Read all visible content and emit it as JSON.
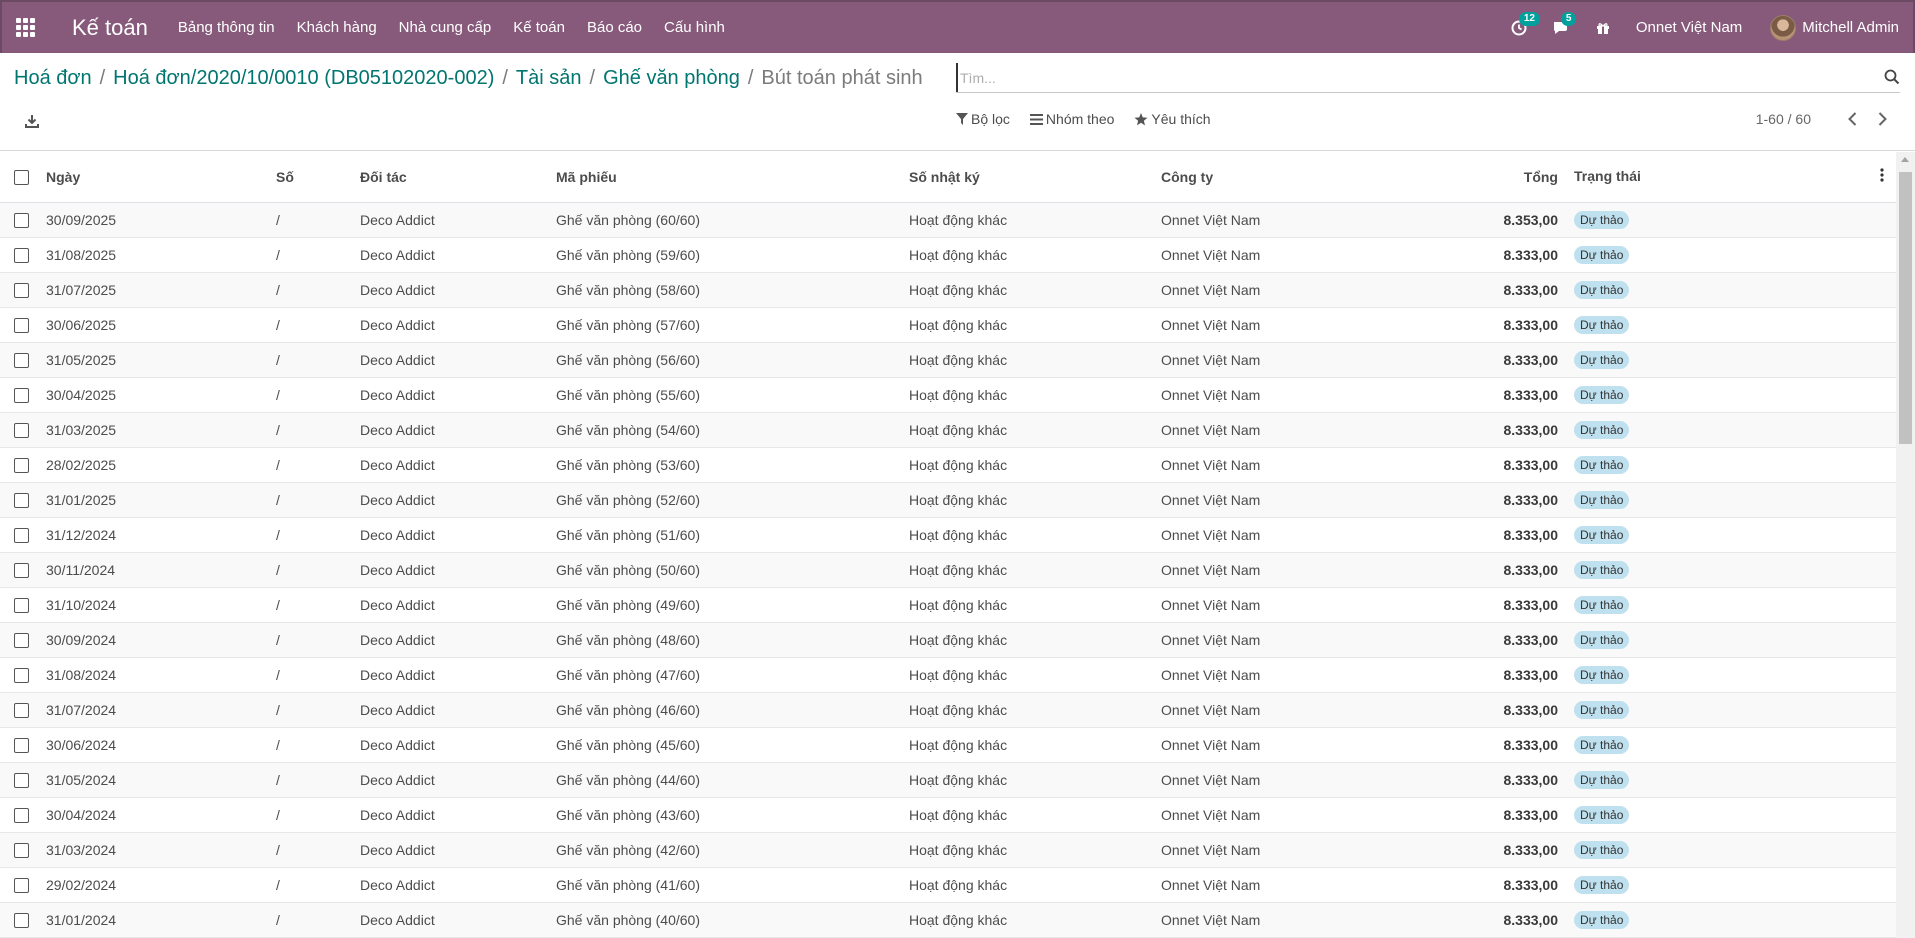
{
  "navbar": {
    "brand": "Kế toán",
    "menu": [
      "Bảng thông tin",
      "Khách hàng",
      "Nhà cung cấp",
      "Kế toán",
      "Báo cáo",
      "Cấu hình"
    ],
    "activity_count": "12",
    "message_count": "5",
    "company": "Onnet Việt Nam",
    "user": "Mitchell Admin",
    "bg_color": "#875a7b"
  },
  "breadcrumb": {
    "items": [
      "Hoá đơn",
      "Hoá đơn/2020/10/0010 (DB05102020-002)",
      "Tài sản",
      "Ghế văn phòng"
    ],
    "current": "Bút toán phát sinh"
  },
  "search": {
    "placeholder": "Tìm..."
  },
  "filters": {
    "filter": "Bộ lọc",
    "group_by": "Nhóm theo",
    "favorites": "Yêu thích"
  },
  "pager": {
    "value": "1-60 / 60"
  },
  "table": {
    "headers": [
      "Ngày",
      "Số",
      "Đối tác",
      "Mã phiếu",
      "Số nhật ký",
      "Công ty",
      "Tổng",
      "Trạng thái"
    ],
    "rows": [
      [
        "30/09/2025",
        "/",
        "Deco Addict",
        "Ghế văn phòng (60/60)",
        "Hoạt động khác",
        "Onnet Việt Nam",
        "8.353,00",
        "Dự thảo"
      ],
      [
        "31/08/2025",
        "/",
        "Deco Addict",
        "Ghế văn phòng (59/60)",
        "Hoạt động khác",
        "Onnet Việt Nam",
        "8.333,00",
        "Dự thảo"
      ],
      [
        "31/07/2025",
        "/",
        "Deco Addict",
        "Ghế văn phòng (58/60)",
        "Hoạt động khác",
        "Onnet Việt Nam",
        "8.333,00",
        "Dự thảo"
      ],
      [
        "30/06/2025",
        "/",
        "Deco Addict",
        "Ghế văn phòng (57/60)",
        "Hoạt động khác",
        "Onnet Việt Nam",
        "8.333,00",
        "Dự thảo"
      ],
      [
        "31/05/2025",
        "/",
        "Deco Addict",
        "Ghế văn phòng (56/60)",
        "Hoạt động khác",
        "Onnet Việt Nam",
        "8.333,00",
        "Dự thảo"
      ],
      [
        "30/04/2025",
        "/",
        "Deco Addict",
        "Ghế văn phòng (55/60)",
        "Hoạt động khác",
        "Onnet Việt Nam",
        "8.333,00",
        "Dự thảo"
      ],
      [
        "31/03/2025",
        "/",
        "Deco Addict",
        "Ghế văn phòng (54/60)",
        "Hoạt động khác",
        "Onnet Việt Nam",
        "8.333,00",
        "Dự thảo"
      ],
      [
        "28/02/2025",
        "/",
        "Deco Addict",
        "Ghế văn phòng (53/60)",
        "Hoạt động khác",
        "Onnet Việt Nam",
        "8.333,00",
        "Dự thảo"
      ],
      [
        "31/01/2025",
        "/",
        "Deco Addict",
        "Ghế văn phòng (52/60)",
        "Hoạt động khác",
        "Onnet Việt Nam",
        "8.333,00",
        "Dự thảo"
      ],
      [
        "31/12/2024",
        "/",
        "Deco Addict",
        "Ghế văn phòng (51/60)",
        "Hoạt động khác",
        "Onnet Việt Nam",
        "8.333,00",
        "Dự thảo"
      ],
      [
        "30/11/2024",
        "/",
        "Deco Addict",
        "Ghế văn phòng (50/60)",
        "Hoạt động khác",
        "Onnet Việt Nam",
        "8.333,00",
        "Dự thảo"
      ],
      [
        "31/10/2024",
        "/",
        "Deco Addict",
        "Ghế văn phòng (49/60)",
        "Hoạt động khác",
        "Onnet Việt Nam",
        "8.333,00",
        "Dự thảo"
      ],
      [
        "30/09/2024",
        "/",
        "Deco Addict",
        "Ghế văn phòng (48/60)",
        "Hoạt động khác",
        "Onnet Việt Nam",
        "8.333,00",
        "Dự thảo"
      ],
      [
        "31/08/2024",
        "/",
        "Deco Addict",
        "Ghế văn phòng (47/60)",
        "Hoạt động khác",
        "Onnet Việt Nam",
        "8.333,00",
        "Dự thảo"
      ],
      [
        "31/07/2024",
        "/",
        "Deco Addict",
        "Ghế văn phòng (46/60)",
        "Hoạt động khác",
        "Onnet Việt Nam",
        "8.333,00",
        "Dự thảo"
      ],
      [
        "30/06/2024",
        "/",
        "Deco Addict",
        "Ghế văn phòng (45/60)",
        "Hoạt động khác",
        "Onnet Việt Nam",
        "8.333,00",
        "Dự thảo"
      ],
      [
        "31/05/2024",
        "/",
        "Deco Addict",
        "Ghế văn phòng (44/60)",
        "Hoạt động khác",
        "Onnet Việt Nam",
        "8.333,00",
        "Dự thảo"
      ],
      [
        "30/04/2024",
        "/",
        "Deco Addict",
        "Ghế văn phòng (43/60)",
        "Hoạt động khác",
        "Onnet Việt Nam",
        "8.333,00",
        "Dự thảo"
      ],
      [
        "31/03/2024",
        "/",
        "Deco Addict",
        "Ghế văn phòng (42/60)",
        "Hoạt động khác",
        "Onnet Việt Nam",
        "8.333,00",
        "Dự thảo"
      ],
      [
        "29/02/2024",
        "/",
        "Deco Addict",
        "Ghế văn phòng (41/60)",
        "Hoạt động khác",
        "Onnet Việt Nam",
        "8.333,00",
        "Dự thảo"
      ],
      [
        "31/01/2024",
        "/",
        "Deco Addict",
        "Ghế văn phòng (40/60)",
        "Hoạt động khác",
        "Onnet Việt Nam",
        "8.333,00",
        "Dự thảo"
      ]
    ]
  },
  "icons": {
    "apps": "apps-grid-icon",
    "activity": "clock-icon",
    "messages": "chat-icon",
    "gift": "gift-icon",
    "download": "download-icon",
    "filter": "funnel-icon",
    "group_by": "bars-icon",
    "favorites": "star-icon",
    "search": "search-icon",
    "options": "vertical-dots-icon"
  }
}
